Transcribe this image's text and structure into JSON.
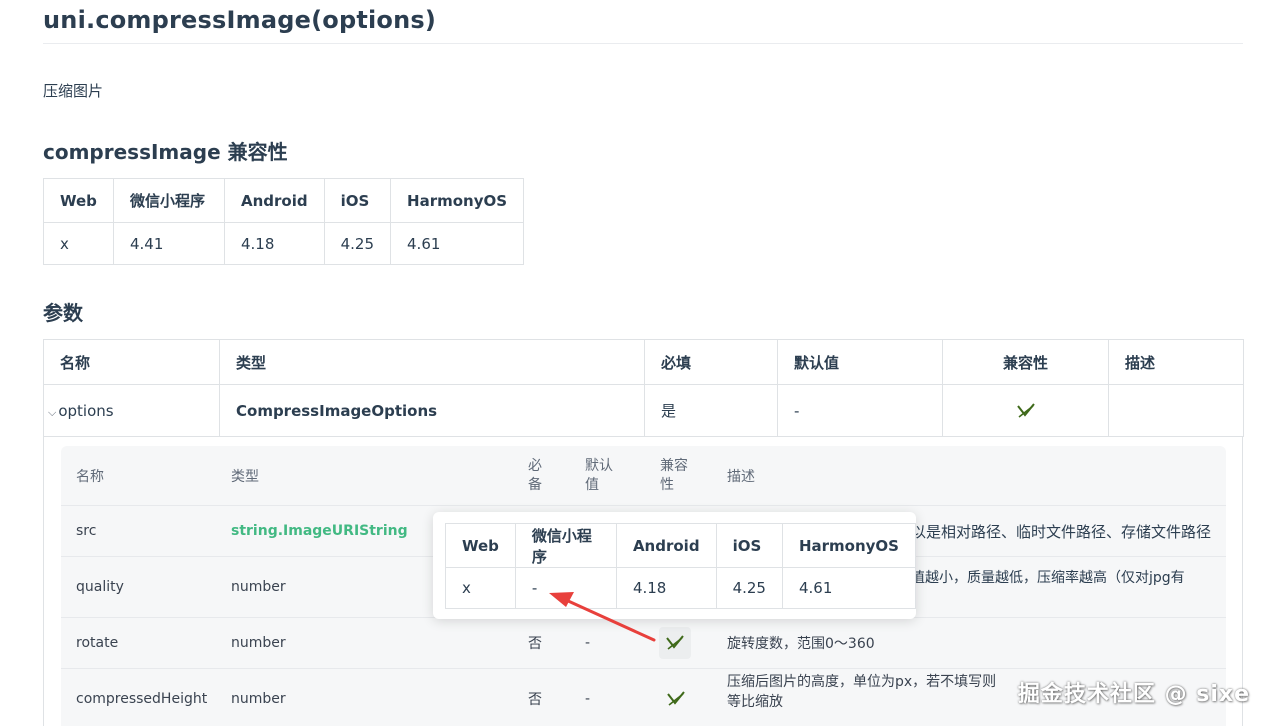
{
  "page": {
    "title": "uni.compressImage(options)",
    "description": "压缩图片"
  },
  "compat_section": {
    "heading": "compressImage 兼容性",
    "headers": [
      "Web",
      "微信小程序",
      "Android",
      "iOS",
      "HarmonyOS"
    ],
    "values": [
      "x",
      "4.41",
      "4.18",
      "4.25",
      "4.61"
    ]
  },
  "params_section": {
    "heading": "参数",
    "headers": [
      "名称",
      "类型",
      "必填",
      "默认值",
      "兼容性",
      "描述"
    ],
    "row": {
      "name": "options",
      "type": "CompressImageOptions",
      "required": "是",
      "default": "-",
      "compat_icon": "check-icon",
      "description": ""
    }
  },
  "sub_table": {
    "headers": [
      "名称",
      "类型",
      "必备",
      "默认值",
      "兼容性",
      "描述"
    ],
    "rows": [
      {
        "name": "src",
        "type": "string.ImageURIString",
        "required": "",
        "default": "",
        "description": "以是相对路径、临时文件路径、存储文件路径"
      },
      {
        "name": "quality",
        "type": "number",
        "required": "",
        "default": "",
        "description": "值越小，质量越低，压缩率越高（仅对jpg有"
      },
      {
        "name": "rotate",
        "type": "number",
        "required": "否",
        "default": "-",
        "description": "旋转度数，范围0～360"
      },
      {
        "name": "compressedHeight",
        "type": "number",
        "required": "否",
        "default": "-",
        "description": "压缩后图片的高度，单位为px，若不填写则",
        "description_line2": "等比缩放"
      }
    ]
  },
  "popover": {
    "headers": [
      "Web",
      "微信小程序",
      "Android",
      "iOS",
      "HarmonyOS"
    ],
    "values": [
      "x",
      "-",
      "4.18",
      "4.25",
      "4.61"
    ]
  },
  "watermark": "掘金技术社区 @ sixe",
  "colors": {
    "link_green": "#42b983",
    "check_green": "#3f6a1a",
    "arrow_red": "#e8403c",
    "border": "#dfe2e5"
  }
}
